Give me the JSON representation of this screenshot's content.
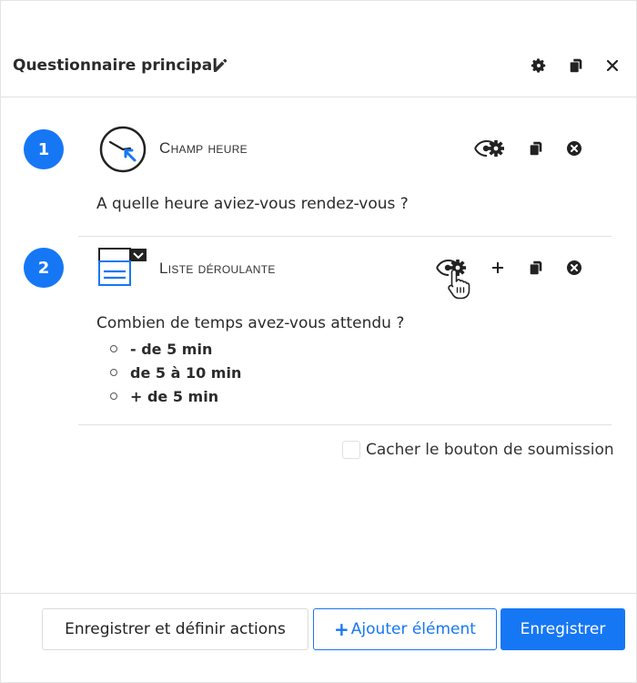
{
  "header": {
    "title": "Questionnaire principal",
    "icons": [
      "pencil-icon",
      "gear-icon",
      "copy-icon",
      "close-icon"
    ]
  },
  "items": [
    {
      "number": "1",
      "type_label": "Champ heure",
      "question": "A quelle heure aviez-vous rendez-vous ?",
      "type_icon": "clock-icon"
    },
    {
      "number": "2",
      "type_label": "Liste déroulante",
      "question": "Combien de temps avez-vous attendu ?",
      "type_icon": "dropdown-list-icon",
      "options": [
        "- de 5 min",
        "de 5 à 10 min",
        "+ de 5 min"
      ]
    }
  ],
  "hide_submit": {
    "label": "Cacher le bouton de soumission",
    "checked": false
  },
  "footer": {
    "save_actions_label": "Enregistrer et définir actions",
    "add_element_plus": "+",
    "add_element_label": "Ajouter élément",
    "save_label": "Enregistrer"
  },
  "colors": {
    "accent": "#1677f5",
    "text": "#2b2b2b"
  }
}
